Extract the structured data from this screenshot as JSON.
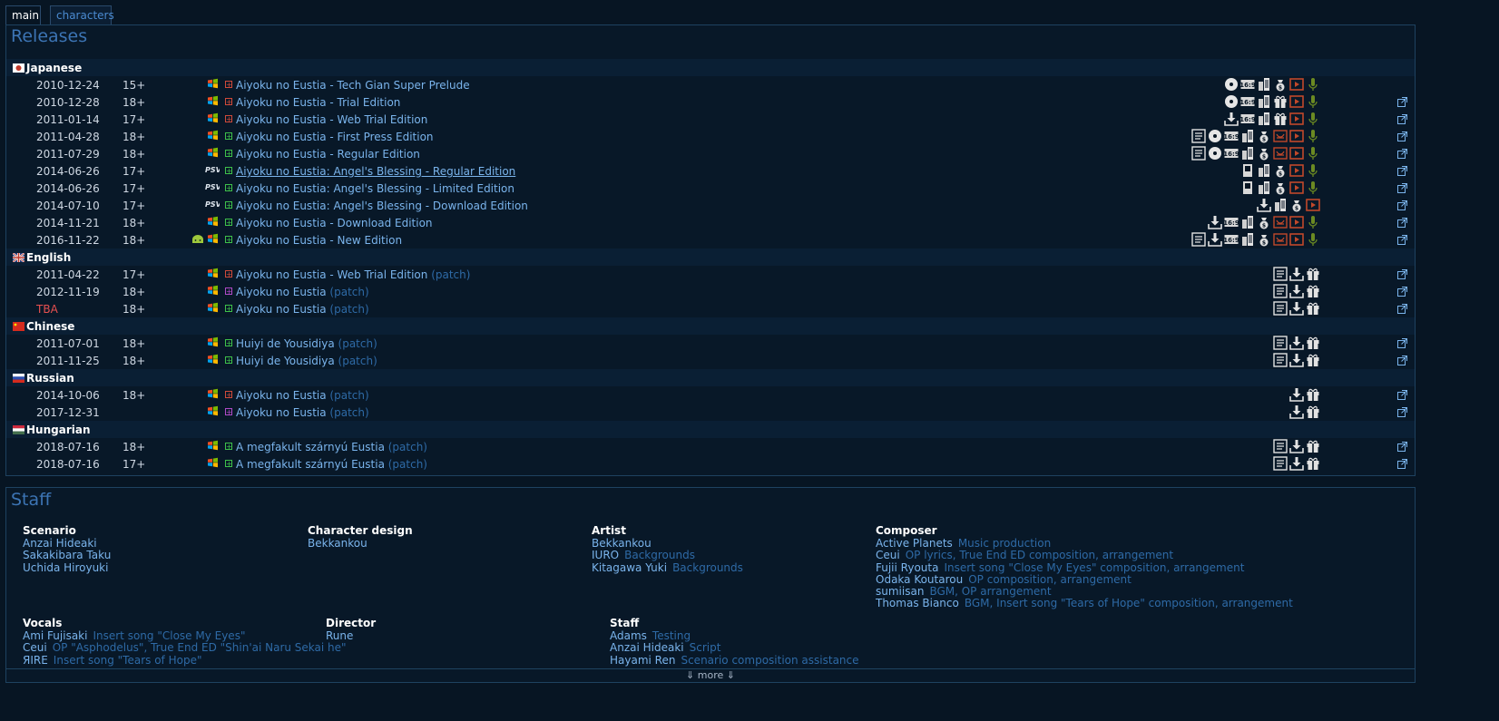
{
  "tabs": [
    {
      "label": "main",
      "active": true
    },
    {
      "label": "characters",
      "active": false
    }
  ],
  "releases": {
    "title": "Releases",
    "groups": [
      {
        "lang": "Japanese",
        "flag": "jp",
        "rows": [
          {
            "date": "2010-12-24",
            "age": "15+",
            "platform": "windows",
            "status": "partial",
            "title": "Aiyoku no Eustia - Tech Gian Super Prelude",
            "patch": "",
            "icons": [
              "disc",
              "ratio",
              "building",
              "money",
              "video",
              "mic"
            ],
            "ext": false
          },
          {
            "date": "2010-12-28",
            "age": "18+",
            "platform": "windows",
            "status": "partial",
            "title": "Aiyoku no Eustia - Trial Edition",
            "patch": "",
            "icons": [
              "disc",
              "ratio",
              "building",
              "gift",
              "video",
              "mic"
            ],
            "ext": true
          },
          {
            "date": "2011-01-14",
            "age": "17+",
            "platform": "windows",
            "status": "partial",
            "title": "Aiyoku no Eustia - Web Trial Edition",
            "patch": "",
            "icons": [
              "download",
              "ratio",
              "building",
              "gift",
              "video",
              "mic"
            ],
            "ext": true
          },
          {
            "date": "2011-04-28",
            "age": "18+",
            "platform": "windows",
            "status": "complete",
            "title": "Aiyoku no Eustia - First Press Edition",
            "patch": "",
            "icons": [
              "doc",
              "disc",
              "ratio",
              "building",
              "money",
              "adult",
              "video",
              "mic"
            ],
            "ext": true
          },
          {
            "date": "2011-07-29",
            "age": "18+",
            "platform": "windows",
            "status": "complete",
            "title": "Aiyoku no Eustia - Regular Edition",
            "patch": "",
            "icons": [
              "doc",
              "disc",
              "ratio",
              "building",
              "money",
              "adult",
              "video",
              "mic"
            ],
            "ext": true
          },
          {
            "date": "2014-06-26",
            "age": "17+",
            "platform": "psv",
            "status": "complete",
            "title": "Aiyoku no Eustia: Angel's Blessing - Regular Edition",
            "patch": "",
            "icons": [
              "card",
              "building",
              "money",
              "video",
              "mic"
            ],
            "ext": true,
            "underline": true
          },
          {
            "date": "2014-06-26",
            "age": "17+",
            "platform": "psv",
            "status": "complete",
            "title": "Aiyoku no Eustia: Angel's Blessing - Limited Edition",
            "patch": "",
            "icons": [
              "card",
              "building",
              "money",
              "video",
              "mic"
            ],
            "ext": true
          },
          {
            "date": "2014-07-10",
            "age": "17+",
            "platform": "psv",
            "status": "complete",
            "title": "Aiyoku no Eustia: Angel's Blessing - Download Edition",
            "patch": "",
            "icons": [
              "download",
              "building",
              "money",
              "video"
            ],
            "ext": true
          },
          {
            "date": "2014-11-21",
            "age": "18+",
            "platform": "windows",
            "status": "complete",
            "title": "Aiyoku no Eustia - Download Edition",
            "patch": "",
            "icons": [
              "download",
              "ratio",
              "building",
              "money",
              "adult",
              "video",
              "mic"
            ],
            "ext": true
          },
          {
            "date": "2016-11-22",
            "age": "18+",
            "platform": "windows",
            "android": true,
            "status": "complete",
            "title": "Aiyoku no Eustia - New Edition",
            "patch": "",
            "icons": [
              "doc",
              "download",
              "ratio",
              "building",
              "money",
              "adult",
              "video",
              "mic"
            ],
            "ext": true
          }
        ]
      },
      {
        "lang": "English",
        "flag": "gb",
        "rows": [
          {
            "date": "2011-04-22",
            "age": "17+",
            "platform": "windows",
            "status": "partial",
            "title": "Aiyoku no Eustia - Web Trial Edition",
            "patch": "(patch)",
            "icons": [
              "doc",
              "download",
              "gift"
            ],
            "ext": true
          },
          {
            "date": "2012-11-19",
            "age": "18+",
            "platform": "windows",
            "status": "mtl",
            "title": "Aiyoku no Eustia",
            "patch": "(patch)",
            "icons": [
              "doc",
              "download",
              "gift"
            ],
            "ext": true
          },
          {
            "date": "TBA",
            "age": "18+",
            "platform": "windows",
            "status": "complete",
            "title": "Aiyoku no Eustia",
            "patch": "(patch)",
            "icons": [
              "doc",
              "download",
              "gift"
            ],
            "ext": true,
            "tba": true
          }
        ]
      },
      {
        "lang": "Chinese",
        "flag": "cn",
        "rows": [
          {
            "date": "2011-07-01",
            "age": "18+",
            "platform": "windows",
            "status": "complete",
            "title": "Huiyi de Yousidiya",
            "patch": "(patch)",
            "icons": [
              "doc",
              "download",
              "gift"
            ],
            "ext": true
          },
          {
            "date": "2011-11-25",
            "age": "18+",
            "platform": "windows",
            "status": "complete",
            "title": "Huiyi de Yousidiya",
            "patch": "(patch)",
            "icons": [
              "doc",
              "download",
              "gift"
            ],
            "ext": true
          }
        ]
      },
      {
        "lang": "Russian",
        "flag": "ru",
        "rows": [
          {
            "date": "2014-10-06",
            "age": "18+",
            "platform": "windows",
            "status": "partial",
            "title": "Aiyoku no Eustia",
            "patch": "(patch)",
            "icons": [
              "download",
              "gift"
            ],
            "ext": true
          },
          {
            "date": "2017-12-31",
            "age": "",
            "platform": "windows",
            "status": "mtl",
            "title": "Aiyoku no Eustia",
            "patch": "(patch)",
            "icons": [
              "download",
              "gift"
            ],
            "ext": true
          }
        ]
      },
      {
        "lang": "Hungarian",
        "flag": "hu",
        "rows": [
          {
            "date": "2018-07-16",
            "age": "18+",
            "platform": "windows",
            "status": "complete",
            "title": "A megfakult szárnyú Eustia",
            "patch": "(patch)",
            "icons": [
              "doc",
              "download",
              "gift"
            ],
            "ext": true
          },
          {
            "date": "2018-07-16",
            "age": "17+",
            "platform": "windows",
            "status": "complete",
            "title": "A megfakult szárnyú Eustia",
            "patch": "(patch)",
            "icons": [
              "doc",
              "download",
              "gift"
            ],
            "ext": true
          }
        ]
      }
    ]
  },
  "staff": {
    "title": "Staff",
    "more": "⇓ more ⇓",
    "columns": [
      {
        "role": "Scenario",
        "people": [
          {
            "name": "Anzai Hideaki",
            "note": ""
          },
          {
            "name": "Sakakibara Taku",
            "note": ""
          },
          {
            "name": "Uchida Hiroyuki",
            "note": ""
          }
        ]
      },
      {
        "role": "Character design",
        "people": [
          {
            "name": "Bekkankou",
            "note": ""
          }
        ]
      },
      {
        "role": "Artist",
        "people": [
          {
            "name": "Bekkankou",
            "note": ""
          },
          {
            "name": "IURO",
            "note": "Backgrounds"
          },
          {
            "name": "Kitagawa Yuki",
            "note": "Backgrounds"
          }
        ]
      },
      {
        "role": "Composer",
        "people": [
          {
            "name": "Active Planets",
            "note": "Music production"
          },
          {
            "name": "Ceui",
            "note": "OP lyrics, True End ED composition, arrangement"
          },
          {
            "name": "Fujii Ryouta",
            "note": "Insert song \"Close My Eyes\" composition, arrangement"
          },
          {
            "name": "Odaka Koutarou",
            "note": "OP composition, arrangement"
          },
          {
            "name": "sumiisan",
            "note": "BGM, OP arrangement"
          },
          {
            "name": "Thomas Bianco",
            "note": "BGM, Insert song \"Tears of Hope\" composition, arrangement"
          }
        ]
      },
      {
        "role": "Vocals",
        "people": [
          {
            "name": "Ami Fujisaki",
            "note": "Insert song \"Close My Eyes\""
          },
          {
            "name": "Ceui",
            "note": "OP \"Asphodelus\", True End ED \"Shin'ai Naru Sekai he\""
          },
          {
            "name": "ЯIRE",
            "note": "Insert song \"Tears of Hope\""
          }
        ]
      },
      {
        "role": "Director",
        "people": [
          {
            "name": "Rune",
            "note": ""
          }
        ]
      },
      {
        "role": "Staff",
        "people": [
          {
            "name": "Adams",
            "note": "Testing"
          },
          {
            "name": "Anzai Hideaki",
            "note": "Script"
          },
          {
            "name": "Hayami Ren",
            "note": "Scenario composition assistance"
          }
        ]
      }
    ]
  }
}
